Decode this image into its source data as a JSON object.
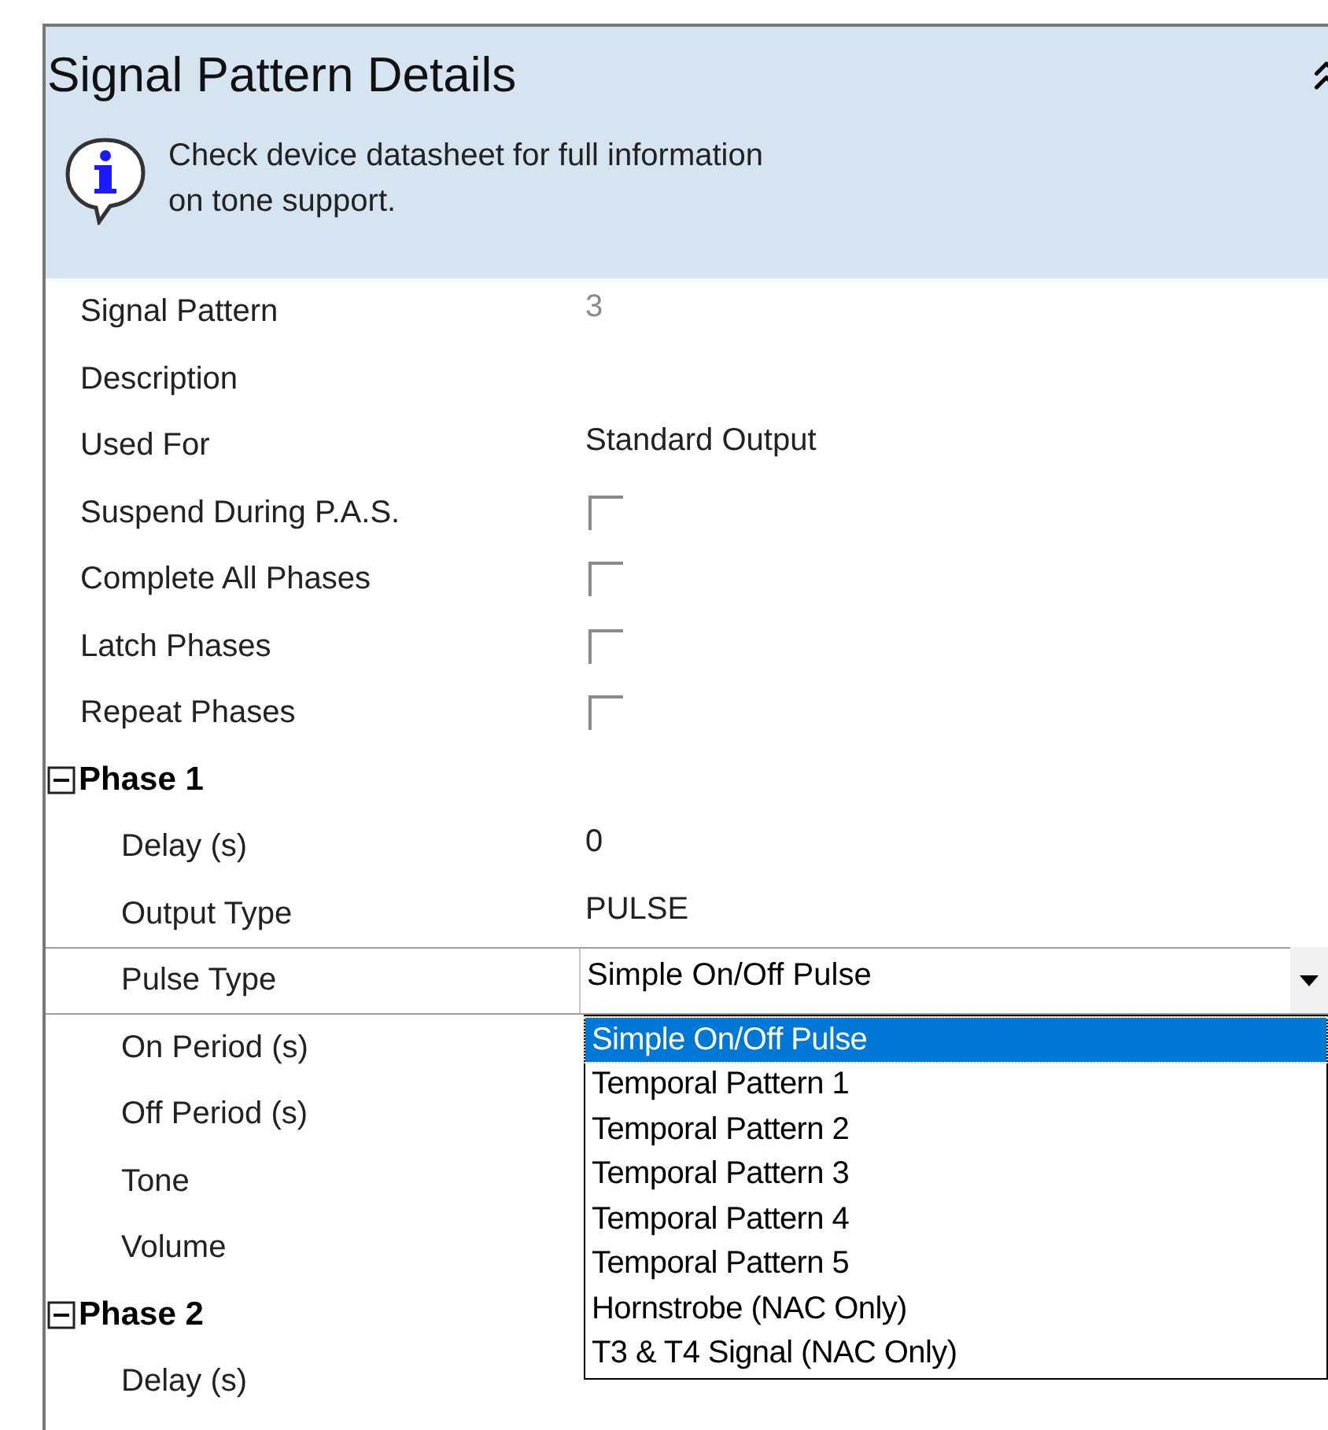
{
  "panel": {
    "title": "Signal Pattern Details",
    "info": "Check device datasheet for full information\non tone support."
  },
  "properties": [
    {
      "kind": "text",
      "label": "Signal Pattern",
      "value": "3",
      "readonly": true
    },
    {
      "kind": "text",
      "label": "Description"
    },
    {
      "kind": "text",
      "label": "Used For",
      "value": "Standard Output",
      "readonly": false
    },
    {
      "kind": "checkbox",
      "label": "Suspend During P.A.S.",
      "checked": false
    },
    {
      "kind": "checkbox",
      "label": "Complete All Phases",
      "checked": false
    },
    {
      "kind": "checkbox",
      "label": "Latch Phases",
      "checked": false
    },
    {
      "kind": "checkbox",
      "label": "Repeat Phases",
      "checked": false
    },
    {
      "kind": "group",
      "label": "Phase 1",
      "expanded": true,
      "children": [
        {
          "kind": "text",
          "label": "Delay (s)",
          "value": "0",
          "readonly": false
        },
        {
          "kind": "text",
          "label": "Output Type",
          "value": "PULSE",
          "readonly": false
        },
        {
          "kind": "combo",
          "label": "Pulse Type",
          "value": "Simple On/Off Pulse",
          "options": [
            {
              "label": "Simple On/Off Pulse",
              "selected": true
            },
            {
              "label": "Temporal Pattern 1",
              "selected": false
            },
            {
              "label": "Temporal Pattern 2",
              "selected": false
            },
            {
              "label": "Temporal Pattern 3",
              "selected": false
            },
            {
              "label": "Temporal Pattern 4",
              "selected": false
            },
            {
              "label": "Temporal Pattern 5",
              "selected": false
            },
            {
              "label": "Hornstrobe (NAC Only)",
              "selected": false
            },
            {
              "label": "T3 & T4 Signal (NAC Only)",
              "selected": false
            }
          ]
        },
        {
          "kind": "text",
          "label": "On Period (s)"
        },
        {
          "kind": "text",
          "label": "Off Period (s)"
        },
        {
          "kind": "text",
          "label": "Tone"
        },
        {
          "kind": "text",
          "label": "Volume"
        }
      ]
    },
    {
      "kind": "group",
      "label": "Phase 2",
      "expanded": true,
      "children": [
        {
          "kind": "text",
          "label": "Delay (s)"
        }
      ]
    }
  ]
}
